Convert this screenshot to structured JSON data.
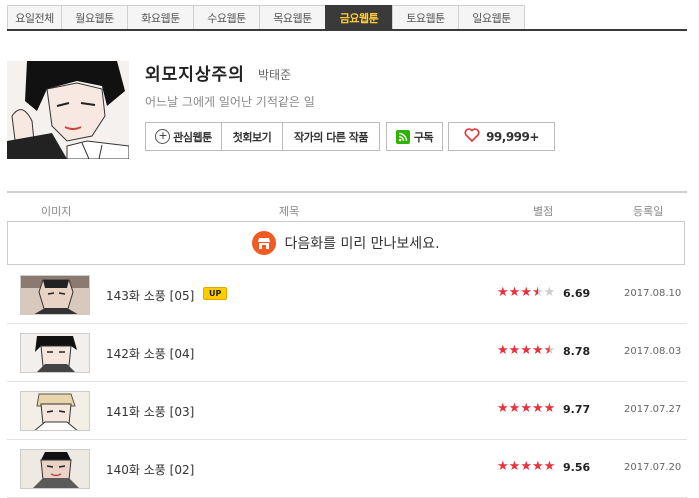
{
  "tabs": [
    {
      "label": "요일전체",
      "active": false,
      "width": 55
    },
    {
      "label": "월요웹툰",
      "active": false,
      "width": 67
    },
    {
      "label": "화요웹툰",
      "active": false,
      "width": 67
    },
    {
      "label": "수요웹툰",
      "active": false,
      "width": 67
    },
    {
      "label": "목요웹툰",
      "active": false,
      "width": 67
    },
    {
      "label": "금요웹툰",
      "active": true,
      "width": 68
    },
    {
      "label": "토요웹툰",
      "active": false,
      "width": 67
    },
    {
      "label": "일요웹툰",
      "active": false,
      "width": 67
    }
  ],
  "header": {
    "title": "외모지상주의",
    "author": "박태준",
    "description": "어느날 그에게 일어난 기적같은 일",
    "favorite_label": "관심웹툰",
    "first_episode_label": "첫회보기",
    "other_works_label": "작가의 다른 작품",
    "subscribe_label": "구독",
    "like_count": "99,999+"
  },
  "table": {
    "col_image": "이미지",
    "col_title": "제목",
    "col_rating": "별점",
    "col_date": "등록일"
  },
  "banner": {
    "text": "다음화를 미리 만나보세요."
  },
  "episodes": [
    {
      "title": "143화 소풍 [05]",
      "badge": "UP",
      "rating": "6.69",
      "stars": 3.5,
      "date": "2017.08.10"
    },
    {
      "title": "142화 소풍 [04]",
      "badge": "",
      "rating": "8.78",
      "stars": 4.5,
      "date": "2017.08.03"
    },
    {
      "title": "141화 소풍 [03]",
      "badge": "",
      "rating": "9.77",
      "stars": 5,
      "date": "2017.07.27"
    },
    {
      "title": "140화 소풍 [02]",
      "badge": "",
      "rating": "9.56",
      "stars": 5,
      "date": "2017.07.20"
    }
  ],
  "colors": {
    "active_tab_bg": "#3a3a3a",
    "active_tab_text": "#ffcc33",
    "star_filled": "#e8323c",
    "star_empty": "#cccccc",
    "subscribe_green": "#2db400",
    "banner_icon": "#f15a24"
  }
}
